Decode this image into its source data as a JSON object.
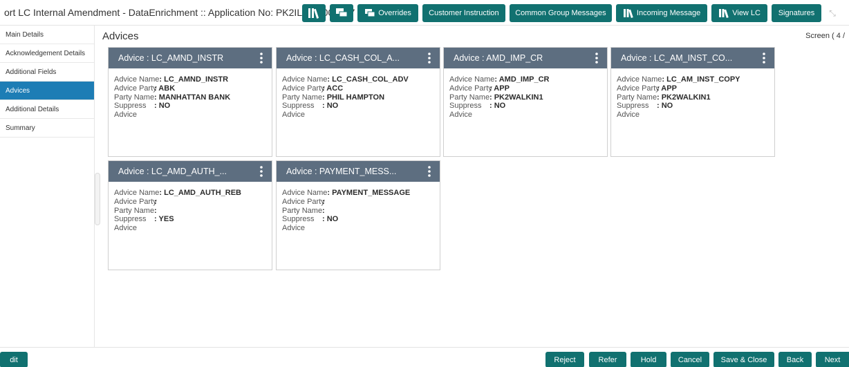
{
  "header": {
    "title": "ort LC Internal Amendment - DataEnrichment :: Application No: PK2ILCI00000707",
    "buttons": {
      "overrides": "Overrides",
      "customer_instruction": "Customer Instruction",
      "common_group_messages": "Common Group Messages",
      "incoming_message": "Incoming Message",
      "view_lc": "View LC",
      "signatures": "Signatures"
    }
  },
  "sidebar": {
    "items": [
      {
        "label": "Main Details"
      },
      {
        "label": "Acknowledgement Details"
      },
      {
        "label": "Additional Fields"
      },
      {
        "label": "Advices"
      },
      {
        "label": "Additional Details"
      },
      {
        "label": "Summary"
      }
    ]
  },
  "main": {
    "title": "Advices",
    "screen_label": "Screen ( 4 /",
    "labels": {
      "advice_name": "Advice Name",
      "advice_party": "Advice Party",
      "party_name": "Party Name",
      "suppress": "Suppress",
      "advice": "Advice"
    },
    "cards": [
      {
        "header": "Advice : LC_AMND_INSTR",
        "advice_name": ": LC_AMND_INSTR",
        "advice_party": ": ABK",
        "party_name": ": MANHATTAN BANK",
        "suppress": ": NO"
      },
      {
        "header": "Advice : LC_CASH_COL_A...",
        "advice_name": ": LC_CASH_COL_ADV",
        "advice_party": ": ACC",
        "party_name": ": PHIL HAMPTON",
        "suppress": ": NO"
      },
      {
        "header": "Advice : AMD_IMP_CR",
        "advice_name": ": AMD_IMP_CR",
        "advice_party": ": APP",
        "party_name": ": PK2WALKIN1",
        "suppress": ": NO"
      },
      {
        "header": "Advice : LC_AM_INST_CO...",
        "advice_name": ": LC_AM_INST_COPY",
        "advice_party": ": APP",
        "party_name": ": PK2WALKIN1",
        "suppress": ": NO"
      },
      {
        "header": "Advice : LC_AMD_AUTH_...",
        "advice_name": ": LC_AMD_AUTH_REB",
        "advice_party": ":",
        "party_name": ":",
        "suppress": ": YES"
      },
      {
        "header": "Advice : PAYMENT_MESS...",
        "advice_name": ": PAYMENT_MESSAGE",
        "advice_party": ":",
        "party_name": ":",
        "suppress": ": NO"
      }
    ]
  },
  "footer": {
    "audit": "dit",
    "reject": "Reject",
    "refer": "Refer",
    "hold": "Hold",
    "cancel": "Cancel",
    "save_close": "Save & Close",
    "back": "Back",
    "next": "Next"
  },
  "colors": {
    "accent": "#117170",
    "card_header": "#5d6e80",
    "active_nav": "#1d7db5"
  }
}
